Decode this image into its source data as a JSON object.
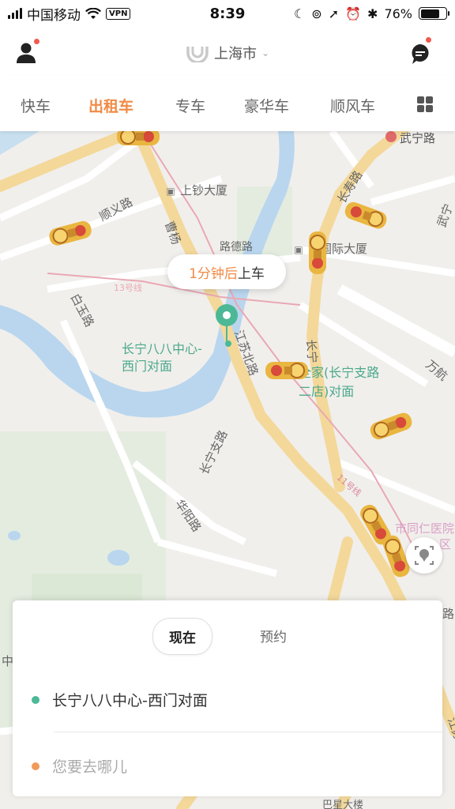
{
  "status_bar": {
    "carrier": "中国移动",
    "vpn": "VPN",
    "time": "8:39",
    "battery": "76%",
    "battery_level": 0.76
  },
  "header": {
    "city": "上海市",
    "brand_color": "#f08a44",
    "avatar_icon": "user-icon",
    "message_icon": "message-icon",
    "dropdown_icon": "chevron-down-icon"
  },
  "tabs": [
    {
      "label": "快车",
      "active": false
    },
    {
      "label": "出租车",
      "active": true
    },
    {
      "label": "专车",
      "active": false
    },
    {
      "label": "豪华车",
      "active": false
    },
    {
      "label": "顺风车",
      "active": false
    }
  ],
  "more_services_icon": "grid-icon",
  "map": {
    "labels": {
      "wuning_road": "武宁路",
      "shanggao": "上钞大厦",
      "shunyi_road": "顺义路",
      "caoyang": "曹杨",
      "road_de": "路德路",
      "line13": "13号线",
      "intl_building": "太国际大厦",
      "changshou_road": "长寿路",
      "wu": "武宁",
      "baiwang_road": "白玉路",
      "jiangsu_north": "江苏北路",
      "changning_zhi": "长宁支路",
      "changning_road": "长宁",
      "wanhang": "万航",
      "huayang_road": "华阳路",
      "line11": "11号线",
      "tongren": "市同仁医院",
      "tongren_sub": "区",
      "pickup_name_1": "长宁八八中心-",
      "pickup_name_2": "西门对面",
      "quanjia_1": "全家(长宁支路",
      "quanjia_2": "二店)对面",
      "zhong": "中",
      "bottom_right_road": "路",
      "road_fragment": "江苏",
      "bottom_building": "巴星大楼",
      "wuding": "武"
    }
  },
  "bubble": {
    "eta": "1分钟后",
    "action": "上车"
  },
  "locate_icon": "locate-icon",
  "card": {
    "time_tabs": [
      "现在",
      "预约"
    ],
    "pickup": "长宁八八中心-西门对面",
    "destination_placeholder": "您要去哪儿",
    "pickup_dot_color": "#4cb896",
    "dest_dot_color": "#f09a5c"
  }
}
